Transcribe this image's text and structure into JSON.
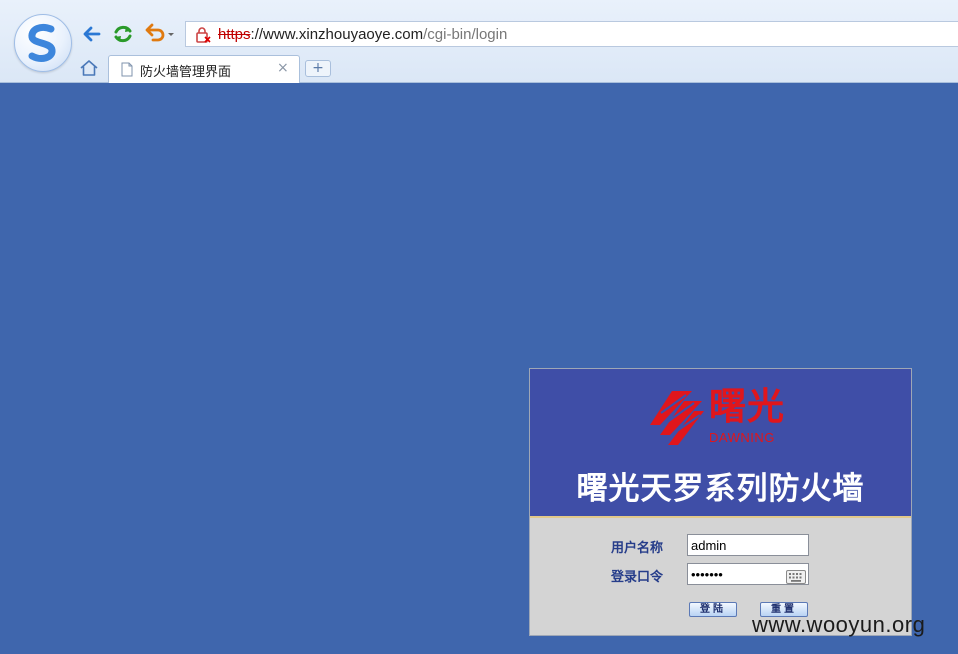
{
  "browser": {
    "url_scheme": "https",
    "url_host": "://www.xinzhouyaoye.com",
    "url_path": "/cgi-bin/login",
    "tab_title": "防火墙管理界面",
    "tab_close": "×",
    "new_tab": "+"
  },
  "login": {
    "brand_cn": "曙光",
    "brand_en": "DAWNING",
    "product_title": "曙光天罗系列防火墙",
    "username_label": "用户名称",
    "username_value": "admin",
    "password_label": "登录口令",
    "password_value": "1234567",
    "login_button": "登陆",
    "reset_button": "重置"
  },
  "watermark": "www.wooyun.org",
  "colors": {
    "page_bg": "#3f66ad",
    "panel_head": "#3f4ea7",
    "brand_red": "#e0161c",
    "label_blue": "#263d8a"
  }
}
